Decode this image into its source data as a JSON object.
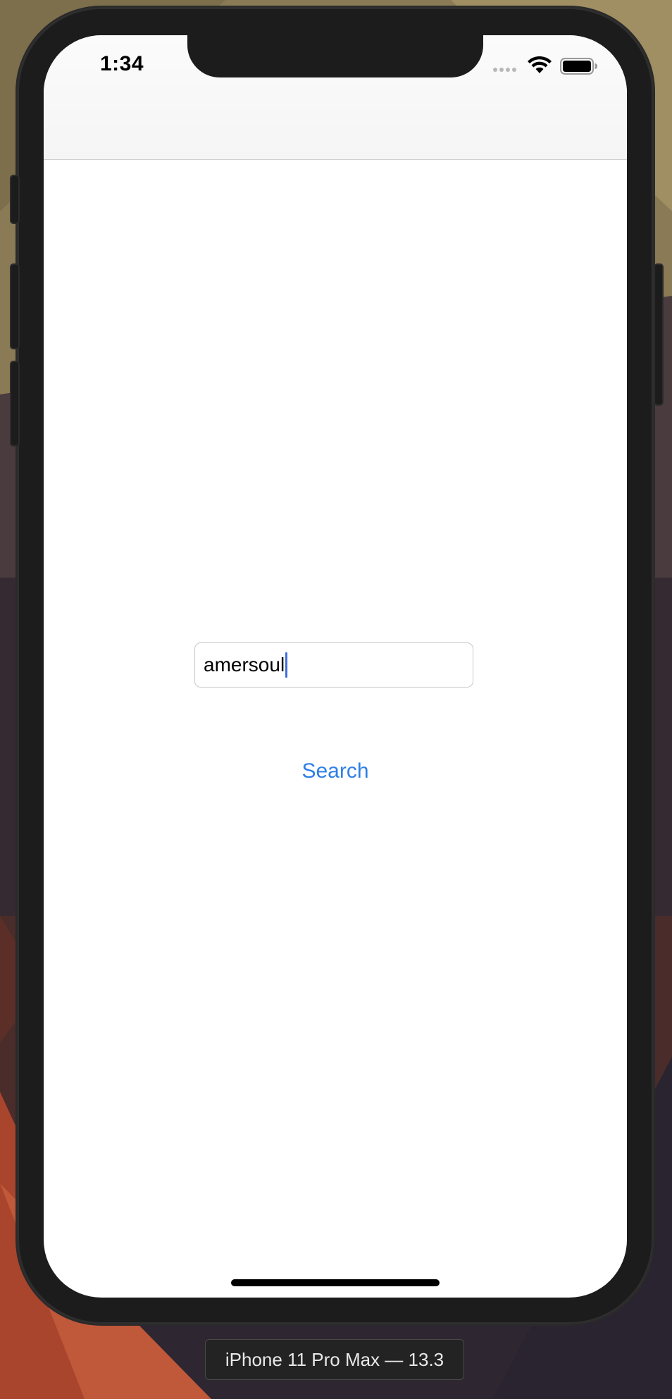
{
  "status_bar": {
    "time": "1:34",
    "icons": [
      "signal-dots-icon",
      "wifi-icon",
      "battery-icon"
    ]
  },
  "search": {
    "input_value": "amersoul",
    "placeholder": "",
    "button_label": "Search"
  },
  "simulator": {
    "device_label": "iPhone 11 Pro Max — 13.3"
  },
  "colors": {
    "accent": "#2f7fe6",
    "caret": "#3f6fe0",
    "device_frame": "#1c1c1c"
  }
}
